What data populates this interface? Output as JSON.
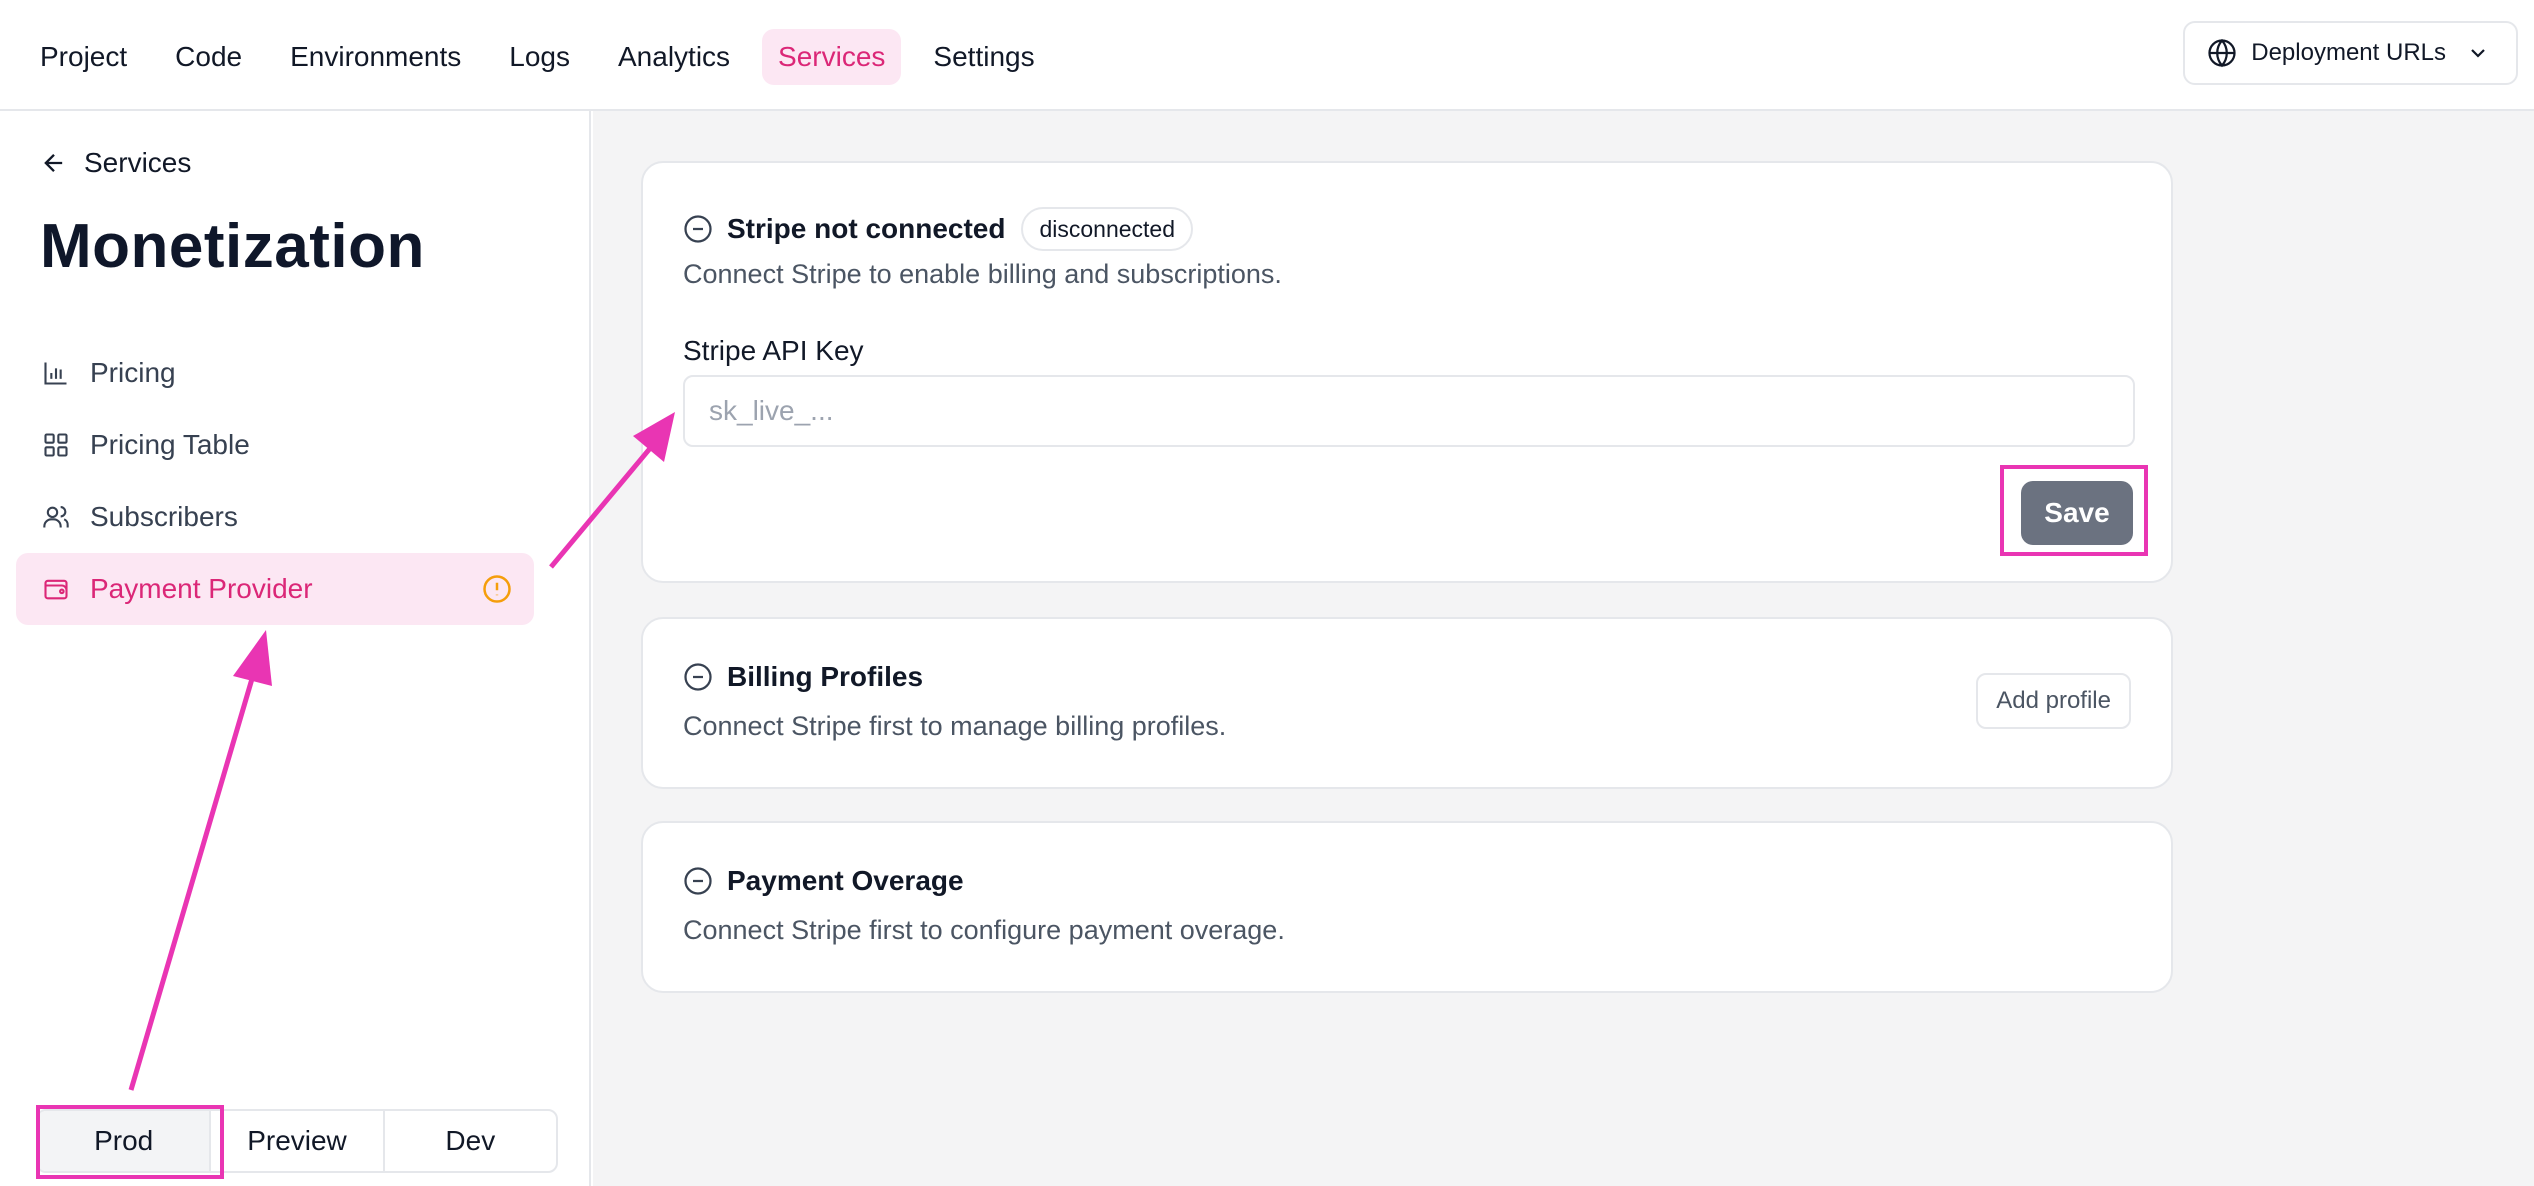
{
  "top_nav": {
    "items": [
      "Project",
      "Code",
      "Environments",
      "Logs",
      "Analytics",
      "Services",
      "Settings"
    ],
    "active": "Services",
    "deployment_urls_label": "Deployment URLs"
  },
  "sidebar": {
    "back_label": "Services",
    "title": "Monetization",
    "items": [
      {
        "label": "Pricing",
        "icon": "bar-chart-icon"
      },
      {
        "label": "Pricing Table",
        "icon": "grid-icon"
      },
      {
        "label": "Subscribers",
        "icon": "users-icon"
      },
      {
        "label": "Payment Provider",
        "icon": "wallet-icon",
        "active": true,
        "status_icon": "warning-icon"
      }
    ],
    "env_switch": {
      "options": [
        "Prod",
        "Preview",
        "Dev"
      ],
      "selected": "Prod"
    }
  },
  "main": {
    "stripe_card": {
      "title": "Stripe not connected",
      "badge": "disconnected",
      "description": "Connect Stripe to enable billing and subscriptions.",
      "field_label": "Stripe API Key",
      "field_value": "",
      "field_placeholder": "sk_live_...",
      "save_label": "Save"
    },
    "billing_card": {
      "title": "Billing Profiles",
      "description": "Connect Stripe first to manage billing profiles.",
      "add_label": "Add profile"
    },
    "overage_card": {
      "title": "Payment Overage",
      "description": "Connect Stripe first to configure payment overage."
    }
  },
  "colors": {
    "accent": "#db2777",
    "accent_bg": "#fce7f3",
    "warning": "#f59e0b",
    "save_button": "#6b7280",
    "annotation": "#e935b3"
  }
}
